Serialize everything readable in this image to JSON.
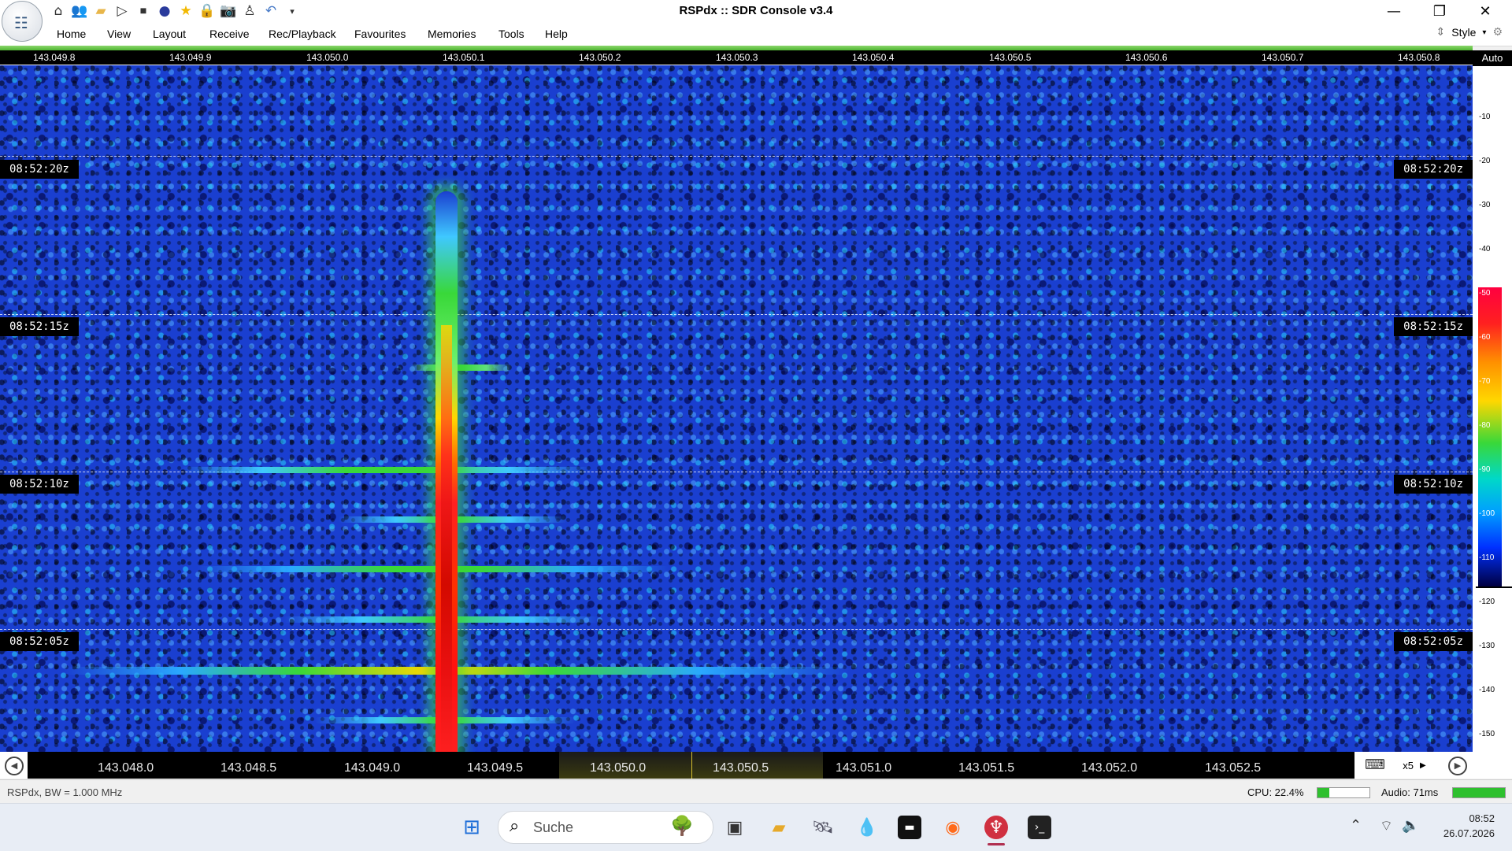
{
  "window": {
    "title": "RSPdx :: SDR Console v3.4",
    "controls": [
      "minimize-icon",
      "restore-icon",
      "close-icon"
    ]
  },
  "quick_access_icons": [
    "home-icon",
    "users-icon",
    "folder-icon",
    "play-icon",
    "stop-icon",
    "record-icon",
    "star-icon",
    "lock-icon",
    "camera-icon",
    "person-icon",
    "undo-icon",
    "dropdown-icon"
  ],
  "menu": {
    "items": [
      "Home",
      "View",
      "Layout",
      "Receive",
      "Rec/Playback",
      "Favourites",
      "Memories",
      "Tools",
      "Help"
    ],
    "style_label": "Style"
  },
  "top_scale": {
    "ticks": [
      "143.049.8",
      "143.049.9",
      "143.050.0",
      "143.050.1",
      "143.050.2",
      "143.050.3",
      "143.050.4",
      "143.050.5",
      "143.050.6",
      "143.050.7",
      "143.050.8"
    ]
  },
  "db_scale": {
    "auto_label": "Auto",
    "ticks": [
      "-10",
      "-20",
      "-30",
      "-40",
      "-50",
      "-60",
      "-70",
      "-80",
      "-90",
      "-100",
      "-110",
      "-120",
      "-130",
      "-140",
      "-150"
    ],
    "colormap": [
      "#ff0040",
      "#ff9000",
      "#ffd700",
      "#39d839",
      "#00d8c8",
      "#00a0ff",
      "#0030ff",
      "#000040"
    ]
  },
  "waterfall": {
    "time_labels": [
      "08:52:20z",
      "08:52:15z",
      "08:52:10z",
      "08:52:05z"
    ],
    "background_color": "#1a3fd0"
  },
  "bottom_scale": {
    "ticks": [
      "143.048.0",
      "143.048.5",
      "143.049.0",
      "143.049.5",
      "143.050.0",
      "143.050.5",
      "143.051.0",
      "143.051.5",
      "143.052.0",
      "143.052.5"
    ],
    "zoom_label": "x5"
  },
  "status": {
    "device_info": "RSPdx, BW = 1.000 MHz",
    "cpu_label": "CPU: 22.4%",
    "cpu_fraction": 0.224,
    "audio_label": "Audio: 71ms",
    "audio_fraction": 1.0
  },
  "taskbar": {
    "search_placeholder": "Suche",
    "apps": [
      "windows-start-icon",
      "file-manager-icon",
      "folder-icon",
      "satellite-icon",
      "drop-app-icon",
      "terminal-icon",
      "firefox-icon",
      "sdr-console-icon",
      "console-icon"
    ],
    "time": "08:52",
    "date": "26.07.2026"
  }
}
